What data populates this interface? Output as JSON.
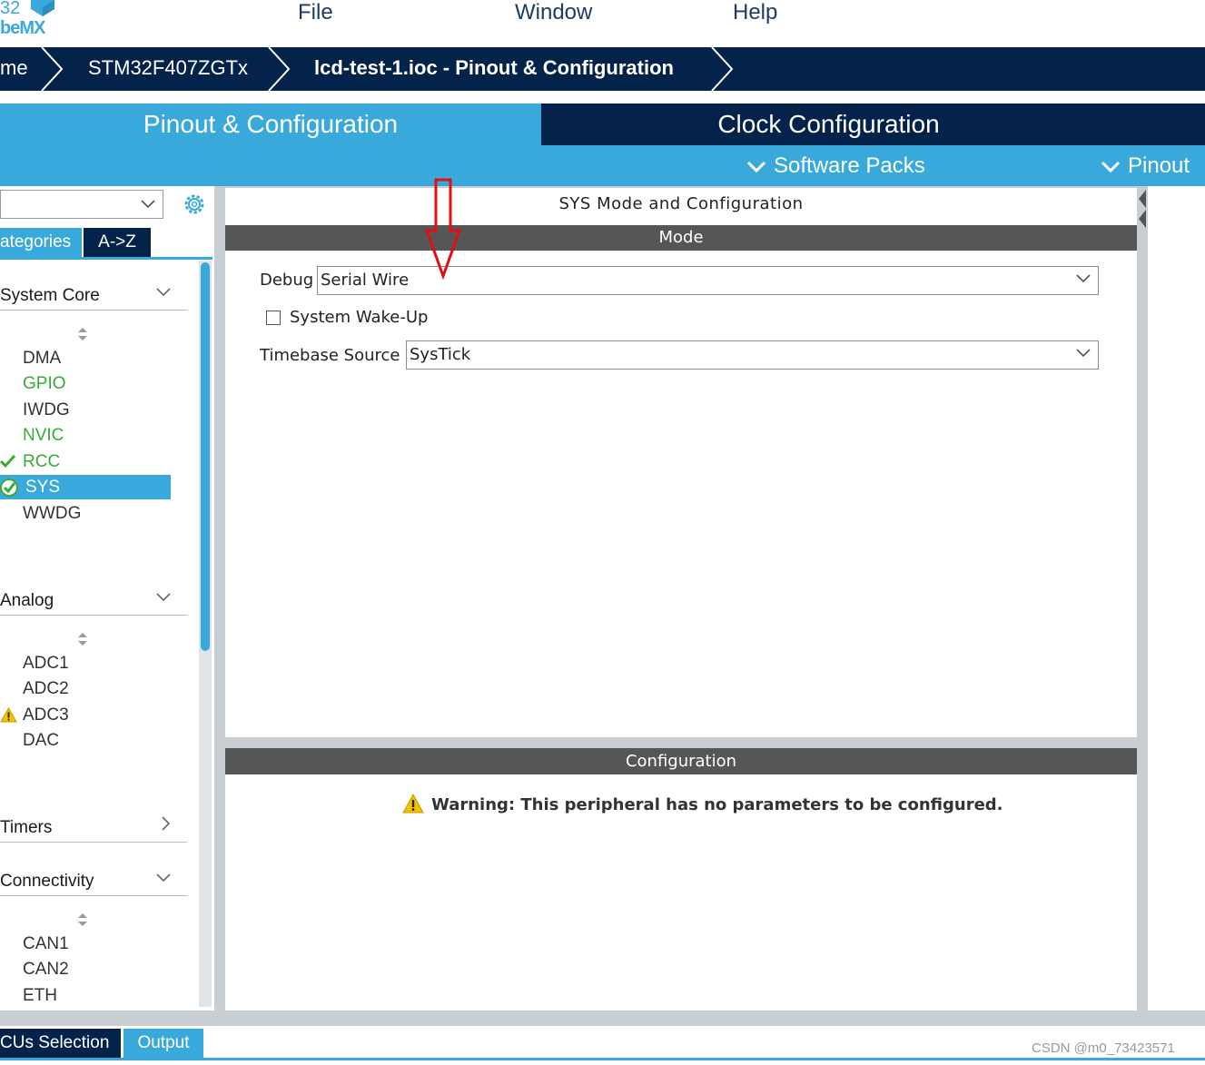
{
  "app": {
    "logo_top": "32",
    "logo_bottom": "beMX"
  },
  "menu": {
    "file": "File",
    "window": "Window",
    "help": "Help"
  },
  "breadcrumb": {
    "items": [
      "me",
      "STM32F407ZGTx",
      "lcd-test-1.ioc - Pinout & Configuration"
    ]
  },
  "tabs": {
    "pinout_config": "Pinout & Configuration",
    "clock_config": "Clock Configuration"
  },
  "subbar": {
    "software_packs": "Software Packs",
    "pinout": "Pinout"
  },
  "left_panel": {
    "tab_categories": "ategories",
    "tab_az": "A->Z",
    "categories": [
      {
        "label": "System Core",
        "expanded": true,
        "items": [
          {
            "label": "DMA",
            "color": "#333333",
            "status": ""
          },
          {
            "label": "GPIO",
            "color": "#3aaa35",
            "status": ""
          },
          {
            "label": "IWDG",
            "color": "#333333",
            "status": ""
          },
          {
            "label": "NVIC",
            "color": "#3aaa35",
            "status": ""
          },
          {
            "label": "RCC",
            "color": "#3aaa35",
            "status": "check"
          },
          {
            "label": "SYS",
            "color": "#ffffff",
            "status": "check-selected"
          },
          {
            "label": "WWDG",
            "color": "#333333",
            "status": ""
          }
        ]
      },
      {
        "label": "Analog",
        "expanded": true,
        "items": [
          {
            "label": "ADC1",
            "status": ""
          },
          {
            "label": "ADC2",
            "status": ""
          },
          {
            "label": "ADC3",
            "status": "warning"
          },
          {
            "label": "DAC",
            "status": ""
          }
        ]
      },
      {
        "label": "Timers",
        "expanded": false,
        "items": []
      },
      {
        "label": "Connectivity",
        "expanded": true,
        "items": [
          {
            "label": "CAN1",
            "status": ""
          },
          {
            "label": "CAN2",
            "status": ""
          },
          {
            "label": "ETH",
            "status": ""
          }
        ]
      }
    ]
  },
  "mode_panel": {
    "title": "SYS Mode and Configuration",
    "section": "Mode",
    "debug_label": "Debug",
    "debug_value": "Serial Wire",
    "wake_up_label": "System Wake-Up",
    "wake_up_checked": false,
    "timebase_label": "Timebase Source",
    "timebase_value": "SysTick"
  },
  "config_panel": {
    "section": "Configuration",
    "warning": "Warning: This peripheral has no parameters to be configured."
  },
  "bottom": {
    "tab_mcus": "CUs Selection",
    "tab_output": "Output",
    "watermark": "CSDN @m0_73423571"
  },
  "colors": {
    "accent": "#39a9db",
    "navy": "#03234b",
    "green": "#3aaa35",
    "section_bar": "#555656"
  }
}
